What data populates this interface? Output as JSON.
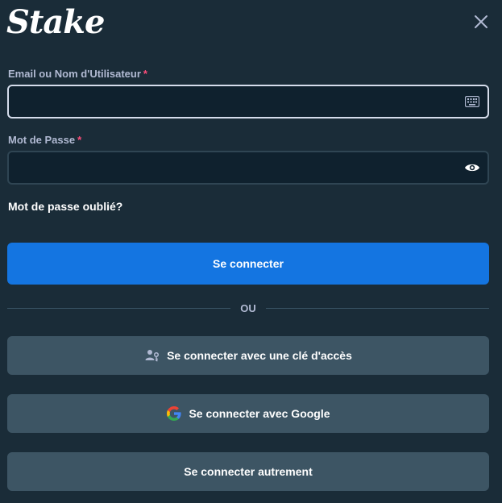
{
  "brand": {
    "logo_text": "Stake"
  },
  "fields": {
    "username": {
      "label": "Email ou Nom d'Utilisateur",
      "required_mark": "*",
      "value": "",
      "placeholder": ""
    },
    "password": {
      "label": "Mot de Passe",
      "required_mark": "*",
      "value": "",
      "placeholder": ""
    }
  },
  "links": {
    "forgot_password": "Mot de passe oublié?"
  },
  "buttons": {
    "login": "Se connecter",
    "passkey": "Se connecter avec une clé d'accès",
    "google": "Se connecter avec Google",
    "other": "Se connecter autrement"
  },
  "divider": {
    "text": "OU"
  },
  "icons": {
    "close": "close-icon",
    "keyboard": "keyboard-icon",
    "eye": "eye-icon",
    "passkey": "passkey-icon",
    "google": "google-icon"
  },
  "colors": {
    "background": "#1a2c38",
    "input_bg": "#0f212e",
    "primary": "#1475e1",
    "secondary_button": "#3d5564",
    "label": "#b1bad3",
    "required": "#ff4d7a"
  }
}
